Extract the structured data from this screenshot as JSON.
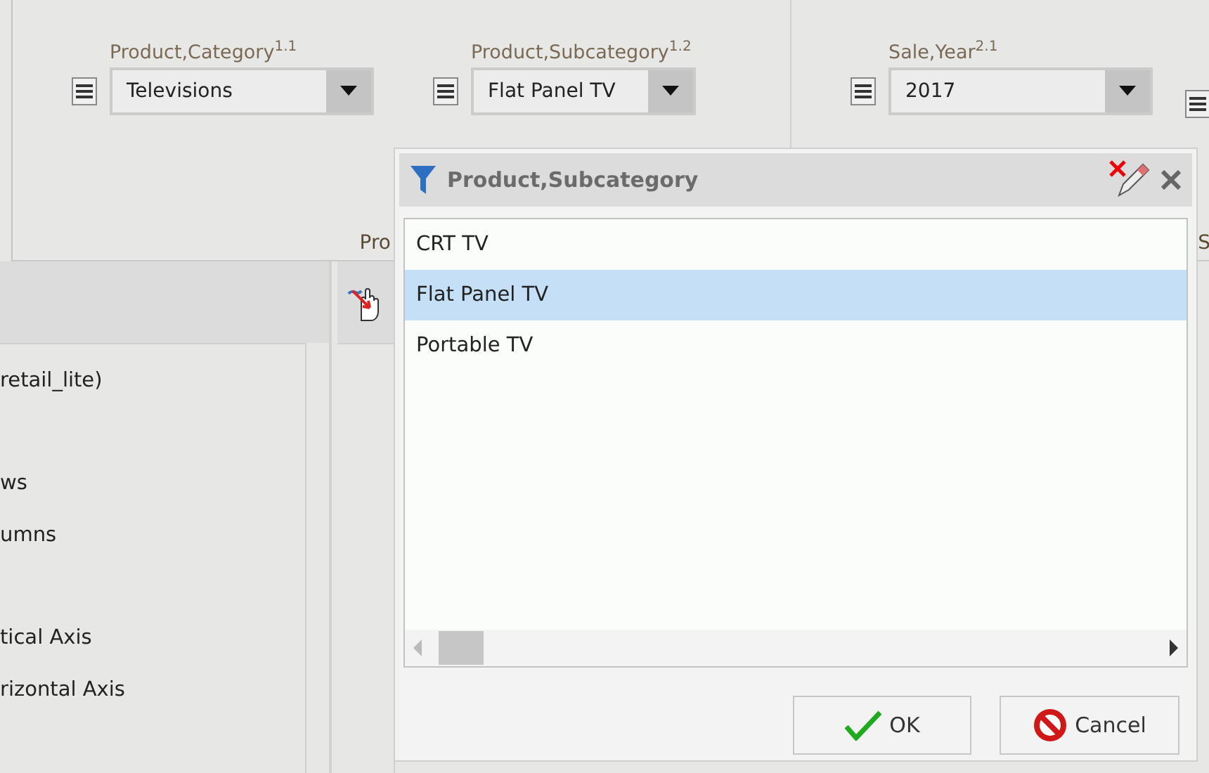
{
  "ribbon": {
    "sections": [
      {
        "caption": "Pro",
        "combos": [
          {
            "label": "Product,Category$^{1.1}$",
            "value": "Televisions"
          },
          {
            "label": "Product,Subcategory$^{1.2}$",
            "value": "Flat Panel TV"
          }
        ]
      },
      {
        "caption": "S",
        "combos": [
          {
            "label": "Sale,Year$^{2.1}$",
            "value": "2017"
          }
        ]
      }
    ]
  },
  "side_panel": {
    "sections": [
      {
        "items": [
          "retail_lite)"
        ]
      },
      {
        "items": [
          "ws",
          "umns"
        ]
      },
      {
        "items": [
          "tical Axis",
          "rizontal Axis"
        ]
      }
    ]
  },
  "filter_dialog": {
    "title": "Product,Subcategory",
    "items": [
      {
        "label": "CRT TV",
        "selected": false
      },
      {
        "label": "Flat Panel TV",
        "selected": true
      },
      {
        "label": "Portable TV",
        "selected": false
      }
    ],
    "buttons": [
      {
        "kind": "ok",
        "label": "OK"
      },
      {
        "kind": "cancel",
        "label": "Cancel"
      }
    ]
  }
}
